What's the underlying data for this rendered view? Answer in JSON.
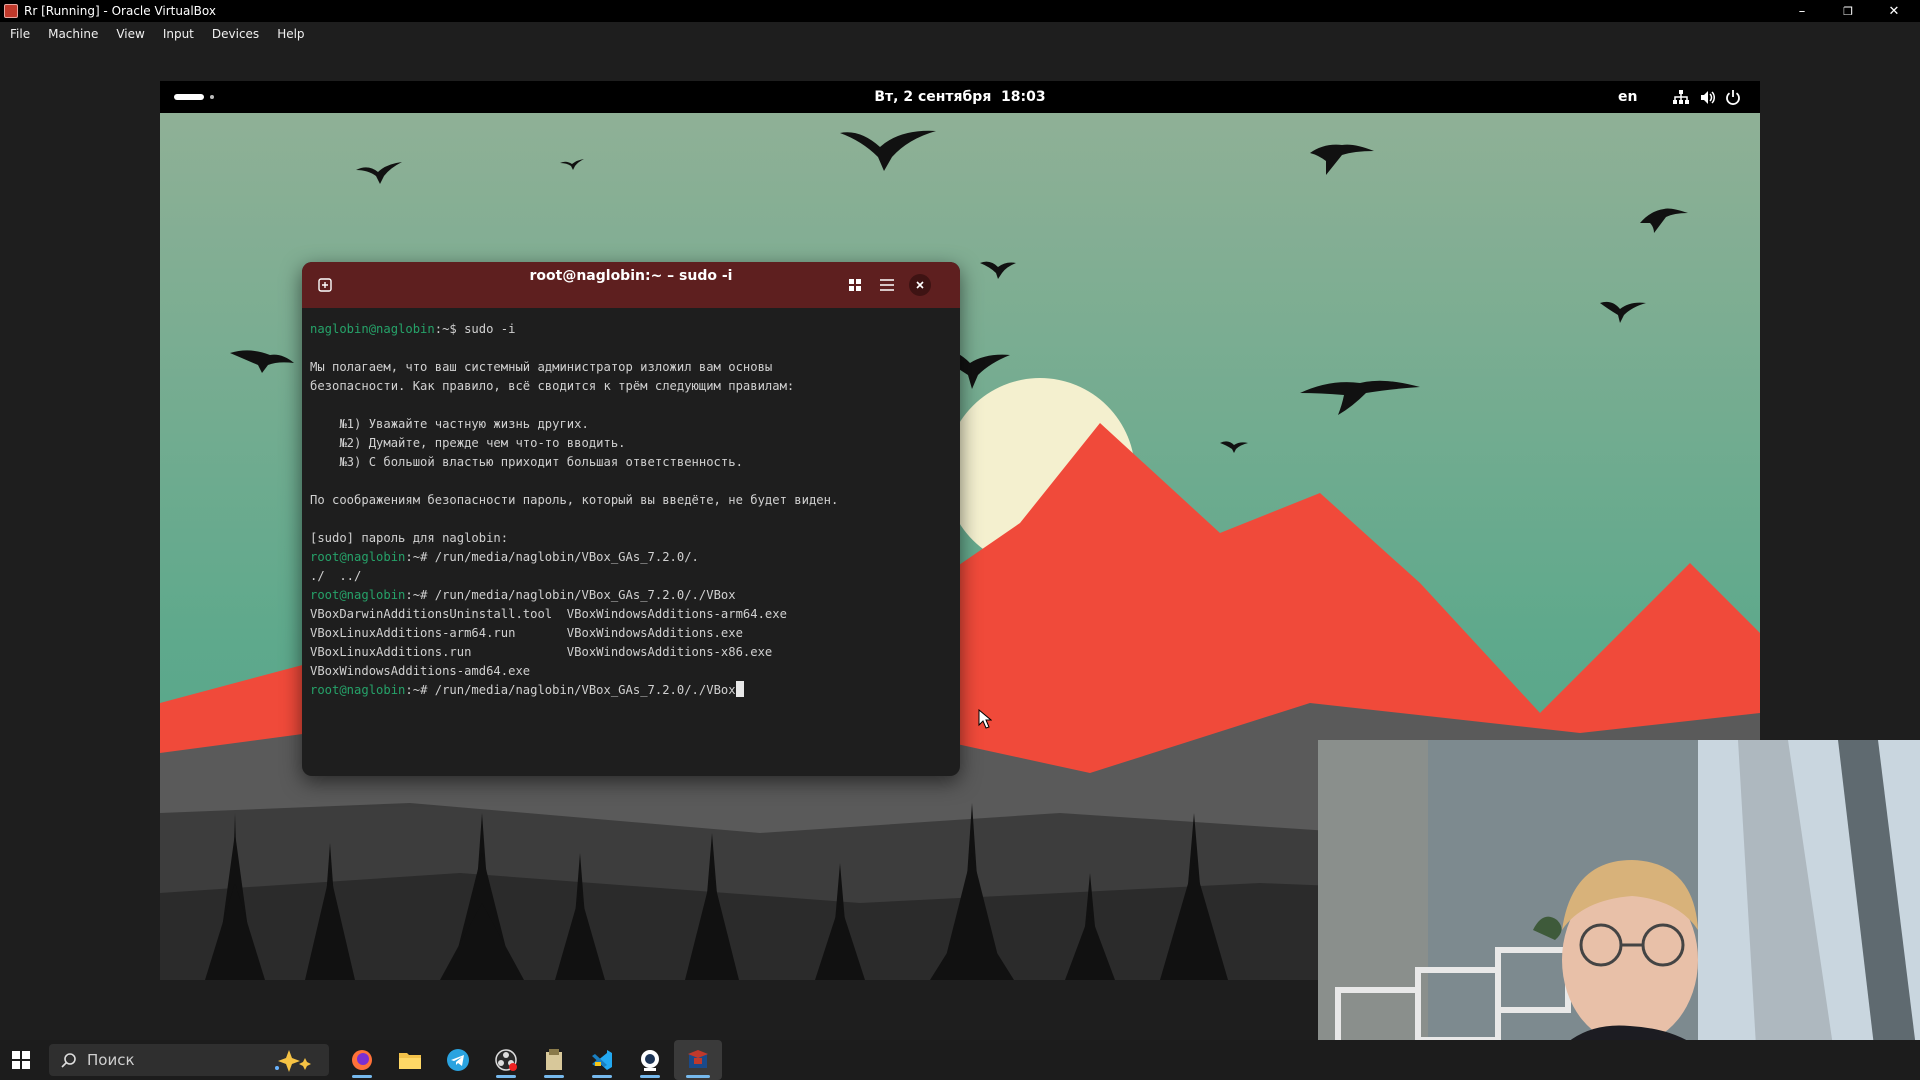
{
  "host_window": {
    "title": "Rr [Running] - Oracle VirtualBox",
    "controls": {
      "minimize": "–",
      "restore": "❐",
      "close": "✕"
    }
  },
  "host_menu": [
    "File",
    "Machine",
    "View",
    "Input",
    "Devices",
    "Help"
  ],
  "gnome_bar": {
    "clock": "Вт, 2 сентября  18:03",
    "keyboard_layout": "en",
    "status_icons": [
      "network-icon",
      "volume-icon",
      "power-icon"
    ]
  },
  "terminal": {
    "title": "root@naglobin:~ – sudo -i",
    "lines": [
      {
        "prompt": "naglobin@naglobin",
        "rest": ":~$ sudo -i"
      },
      {
        "text": ""
      },
      {
        "text": "Мы полагаем, что ваш системный администратор изложил вам основы"
      },
      {
        "text": "безопасности. Как правило, всё сводится к трём следующим правилам:"
      },
      {
        "text": ""
      },
      {
        "text": "    №1) Уважайте частную жизнь других."
      },
      {
        "text": "    №2) Думайте, прежде чем что-то вводить."
      },
      {
        "text": "    №3) С большой властью приходит большая ответственность."
      },
      {
        "text": ""
      },
      {
        "text": "По соображениям безопасности пароль, который вы введёте, не будет виден."
      },
      {
        "text": ""
      },
      {
        "text": "[sudo] пароль для naglobin:"
      },
      {
        "prompt": "root@naglobin",
        "rest": ":~# /run/media/naglobin/VBox_GAs_7.2.0/."
      },
      {
        "text": "./  ../"
      },
      {
        "prompt": "root@naglobin",
        "rest": ":~# /run/media/naglobin/VBox_GAs_7.2.0/./VBox"
      },
      {
        "text": "VBoxDarwinAdditionsUninstall.tool  VBoxWindowsAdditions-arm64.exe"
      },
      {
        "text": "VBoxLinuxAdditions-arm64.run       VBoxWindowsAdditions.exe"
      },
      {
        "text": "VBoxLinuxAdditions.run             VBoxWindowsAdditions-x86.exe"
      },
      {
        "text": "VBoxWindowsAdditions-amd64.exe"
      },
      {
        "prompt": "root@naglobin",
        "rest": ":~# /run/media/naglobin/VBox_GAs_7.2.0/./VBox",
        "cursor": true
      }
    ]
  },
  "taskbar": {
    "search_placeholder": "Поиск",
    "apps": [
      "firefox-icon",
      "file-explorer-icon",
      "telegram-icon",
      "obs-icon",
      "app-icon",
      "vscode-icon",
      "webcam-app-icon",
      "virtualbox-icon"
    ]
  },
  "colors": {
    "prompt_green": "#26a269",
    "terminal_header": "#5e1f1f",
    "sky": "#6f9e8c",
    "mountain": "#f04a3a"
  }
}
